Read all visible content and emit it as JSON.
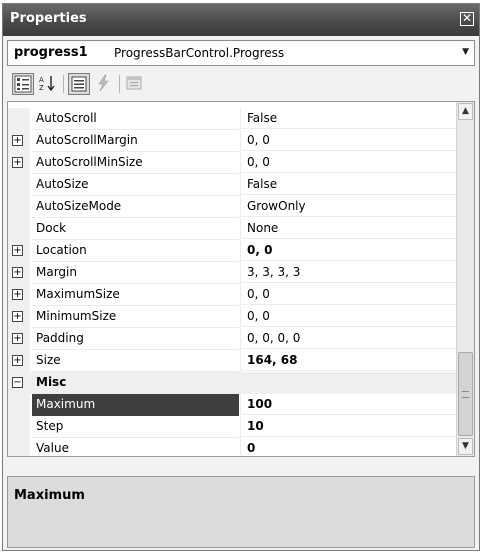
{
  "window": {
    "title": "Properties"
  },
  "object_selector": {
    "name": "progress1",
    "type": "ProgressBarControl.Progress"
  },
  "toolbar": {
    "buttons": [
      "categorized-icon",
      "alphabetical-icon",
      "properties-icon",
      "events-icon",
      "property-pages-icon"
    ]
  },
  "grid": {
    "rows": [
      {
        "kind": "prop",
        "name": "AutoScroll",
        "value": "False",
        "expandable": false,
        "bold": false
      },
      {
        "kind": "prop",
        "name": "AutoScrollMargin",
        "value": "0, 0",
        "expandable": true,
        "bold": false
      },
      {
        "kind": "prop",
        "name": "AutoScrollMinSize",
        "value": "0, 0",
        "expandable": true,
        "bold": false
      },
      {
        "kind": "prop",
        "name": "AutoSize",
        "value": "False",
        "expandable": false,
        "bold": false
      },
      {
        "kind": "prop",
        "name": "AutoSizeMode",
        "value": "GrowOnly",
        "expandable": false,
        "bold": false
      },
      {
        "kind": "prop",
        "name": "Dock",
        "value": "None",
        "expandable": false,
        "bold": false
      },
      {
        "kind": "prop",
        "name": "Location",
        "value": "0, 0",
        "expandable": true,
        "bold": true
      },
      {
        "kind": "prop",
        "name": "Margin",
        "value": "3, 3, 3, 3",
        "expandable": true,
        "bold": false
      },
      {
        "kind": "prop",
        "name": "MaximumSize",
        "value": "0, 0",
        "expandable": true,
        "bold": false
      },
      {
        "kind": "prop",
        "name": "MinimumSize",
        "value": "0, 0",
        "expandable": true,
        "bold": false
      },
      {
        "kind": "prop",
        "name": "Padding",
        "value": "0, 0, 0, 0",
        "expandable": true,
        "bold": false
      },
      {
        "kind": "prop",
        "name": "Size",
        "value": "164, 68",
        "expandable": true,
        "bold": true
      },
      {
        "kind": "category",
        "name": "Misc",
        "value": "",
        "expandable": true,
        "bold": true
      },
      {
        "kind": "prop",
        "name": "Maximum",
        "value": "100",
        "expandable": false,
        "bold": true,
        "selected": true
      },
      {
        "kind": "prop",
        "name": "Step",
        "value": "10",
        "expandable": false,
        "bold": true
      },
      {
        "kind": "prop",
        "name": "Value",
        "value": "0",
        "expandable": false,
        "bold": true
      }
    ]
  },
  "description": {
    "title": "Maximum"
  },
  "glyphs": {
    "close": "✕",
    "collapse": "−",
    "expand": "+",
    "dropdown": "▼",
    "up": "▲",
    "down": "▼"
  }
}
